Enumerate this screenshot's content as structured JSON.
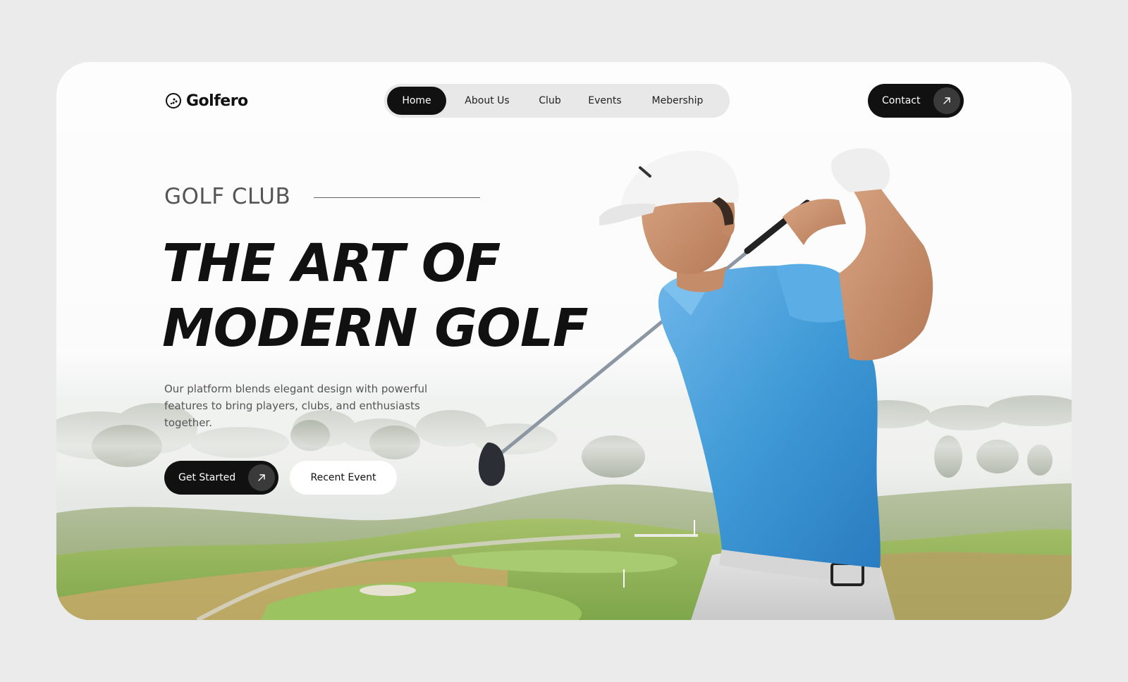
{
  "brand": {
    "name": "Golfero",
    "logo_icon": "golf-ball-icon"
  },
  "nav": {
    "items": [
      {
        "label": "Home",
        "active": true
      },
      {
        "label": "About Us",
        "active": false
      },
      {
        "label": "Club",
        "active": false
      },
      {
        "label": "Events",
        "active": false
      },
      {
        "label": "Mebership",
        "active": false
      }
    ]
  },
  "header": {
    "contact_label": "Contact",
    "contact_icon": "arrow-up-right-icon"
  },
  "hero": {
    "eyebrow": "GOLF CLUB",
    "headline_line1": "THE ART OF",
    "headline_line2": "MODERN GOLF",
    "description": "Our platform blends elegant design with powerful features to bring players, clubs, and enthusiasts together.",
    "primary_button": "Get Started",
    "primary_button_icon": "arrow-up-right-icon",
    "secondary_button": "Recent Event"
  },
  "colors": {
    "page_background": "#ebebeb",
    "card_background": "#fdfdfd",
    "dark": "#111111",
    "nav_background": "#e8e8e8",
    "shirt_blue": "#3f9ad6",
    "grass_green": "#7fa84a"
  }
}
